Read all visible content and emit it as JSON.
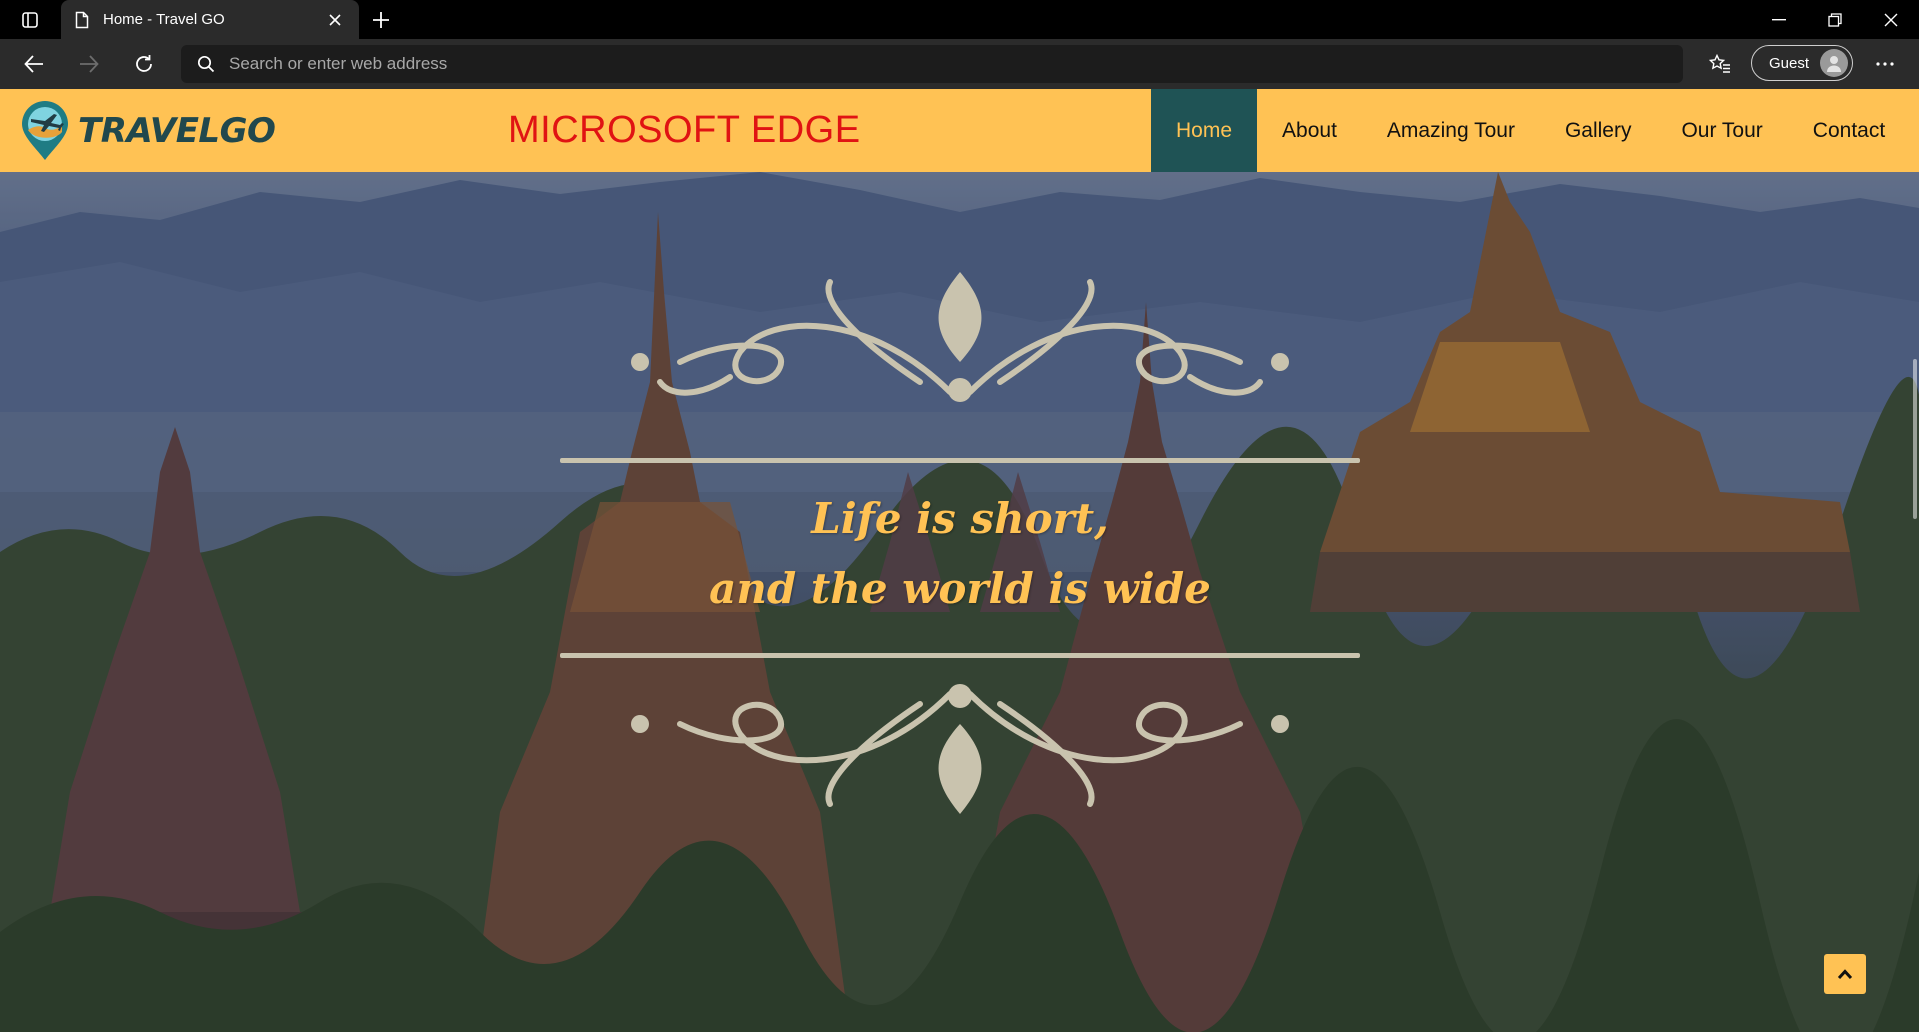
{
  "browser": {
    "tab_title": "Home - Travel GO",
    "address_placeholder": "Search or enter web address",
    "guest_label": "Guest",
    "icons": {
      "tab_actions": "tab-actions-icon",
      "page": "page-icon",
      "close": "close-icon",
      "new_tab": "plus-icon",
      "minimize": "minimize-icon",
      "restore": "restore-icon",
      "window_close": "close-icon",
      "back": "arrow-left-icon",
      "forward": "arrow-right-icon",
      "refresh": "refresh-icon",
      "search": "search-icon",
      "favorites": "star-list-icon",
      "avatar": "profile-icon",
      "more": "more-icon"
    }
  },
  "site": {
    "logo_text": "TRAVELGO",
    "headline": "MICROSOFT EDGE",
    "nav": [
      {
        "label": "Home",
        "active": true
      },
      {
        "label": "About",
        "active": false
      },
      {
        "label": "Amazing Tour",
        "active": false
      },
      {
        "label": "Gallery",
        "active": false
      },
      {
        "label": "Our Tour",
        "active": false
      },
      {
        "label": "Contact",
        "active": false
      }
    ],
    "hero": {
      "quote_line1": "Life is short,",
      "quote_line2": "and the world is wide"
    },
    "colors": {
      "header_bg": "#ffc254",
      "nav_active_bg": "#1f5355",
      "headline": "#e01313",
      "accent": "#ffc254",
      "ornament": "#c9c3ae"
    }
  }
}
